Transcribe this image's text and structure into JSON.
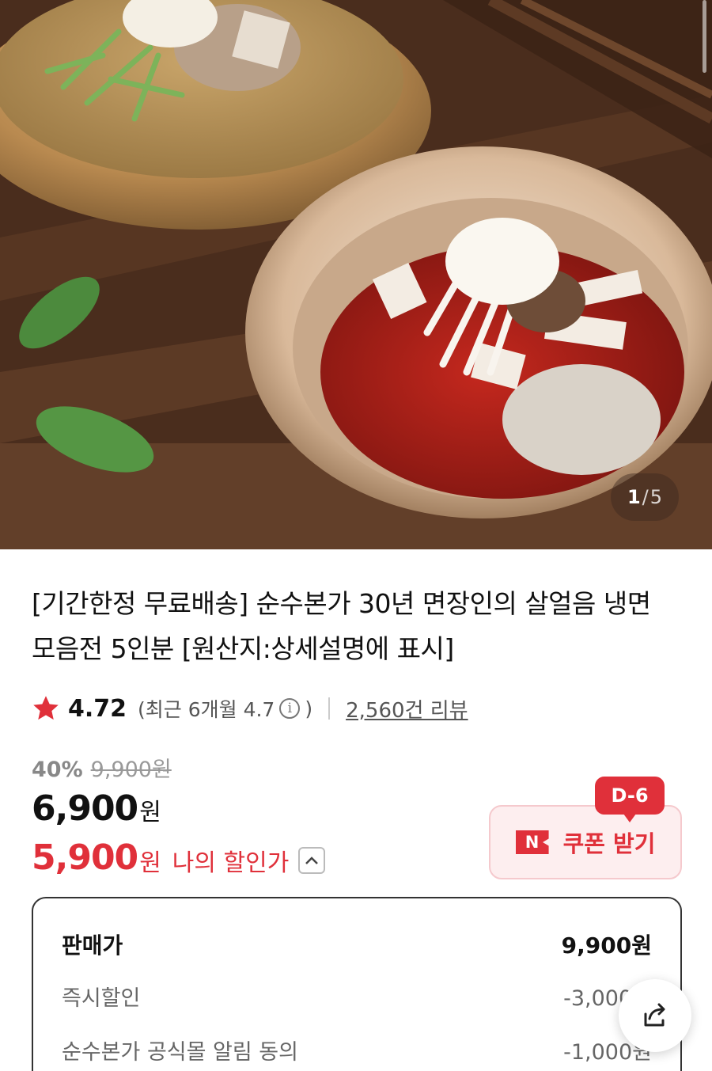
{
  "gallery": {
    "current": "1",
    "separator": "/",
    "total": "5"
  },
  "product": {
    "title": "[기간한정 무료배송] 순수본가 30년 면장인의 살얼음 냉면 모음전 5인분 [원산지:상세설명에 표시]"
  },
  "rating": {
    "value": "4.72",
    "recent_label": "(최근 6개월 4.7",
    "info_glyph": "i",
    "recent_close": ")",
    "reviews": "2,560건 리뷰",
    "star_color": "#e0303a"
  },
  "pricing": {
    "discount_pct": "40%",
    "original_price": "9,900원",
    "sale_price": "6,900",
    "won": "원",
    "my_price": "5,900",
    "my_price_won": "원",
    "my_price_label": "나의 할인가",
    "accent_color": "#e0303a"
  },
  "coupon": {
    "badge": "D-6",
    "n_logo": "N",
    "label": "쿠폰 받기"
  },
  "breakdown": {
    "rows": [
      {
        "label": "판매가",
        "value": "9,900원"
      },
      {
        "label": "즉시할인",
        "value": "-3,000원"
      },
      {
        "label": "순수본가 공식몰 알림 동의",
        "value": "-1,000원"
      }
    ]
  },
  "icons": {
    "star": "star-icon",
    "info": "info-icon",
    "chevron": "chevron-up-icon",
    "share": "share-icon"
  }
}
